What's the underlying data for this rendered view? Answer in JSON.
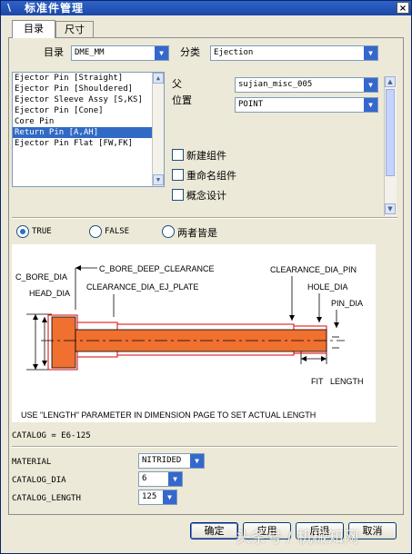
{
  "window": {
    "title": "标准件管理",
    "close_glyph": "×",
    "menu_glyph": "\\"
  },
  "tabs": [
    {
      "label": "目录"
    },
    {
      "label": "尺寸"
    }
  ],
  "catalog": {
    "label": "目录",
    "value": "DME_MM"
  },
  "category": {
    "label": "分类",
    "value": "Ejection"
  },
  "parts_list": [
    "Ejector Pin [Straight]",
    "Ejector Pin [Shouldered]",
    "Ejector Sleeve Assy [S,KS]",
    "Ejector Pin [Cone]",
    "Core Pin",
    "Return Pin [A,AH]",
    "Ejector Pin Flat [FW,FK]"
  ],
  "parent": {
    "label": "父",
    "value": "sujian_misc_005"
  },
  "position": {
    "label": "位置",
    "value": "POINT"
  },
  "options": [
    {
      "label": "新建组件"
    },
    {
      "label": "重命名组件"
    },
    {
      "label": "概念设计"
    }
  ],
  "radios": [
    {
      "label": "TRUE"
    },
    {
      "label": "FALSE"
    },
    {
      "label": "两者皆是"
    }
  ],
  "diagram": {
    "c_bore_dia": "C_BORE_DIA",
    "c_bore_deep_clearance": "C_BORE_DEEP_CLEARANCE",
    "clearance_dia_pin": "CLEARANCE_DIA_PIN",
    "head_dia": "HEAD_DIA",
    "clearance_dia_ej_plate": "CLEARANCE_DIA_EJ_PLATE",
    "hole_dia": "HOLE_DIA",
    "pin_dia": "PIN_DIA",
    "fit": "FIT",
    "length": "LENGTH",
    "note": "USE \"LENGTH\" PARAMETER IN DIMENSION PAGE TO SET ACTUAL LENGTH",
    "colors": {
      "pin": "#f07030",
      "outline": "#e00000"
    }
  },
  "catalog_code": "CATALOG = E6-125",
  "material": {
    "label": "MATERIAL",
    "value": "NITRIDED"
  },
  "catalog_dia": {
    "label": "CATALOG_DIA",
    "value": "6"
  },
  "catalog_length": {
    "label": "CATALOG_LENGTH",
    "value": "125"
  },
  "buttons": {
    "ok": "确定",
    "apply": "应用",
    "back": "后退",
    "cancel": "取消"
  },
  "watermark": "头条号 / 机械知网"
}
